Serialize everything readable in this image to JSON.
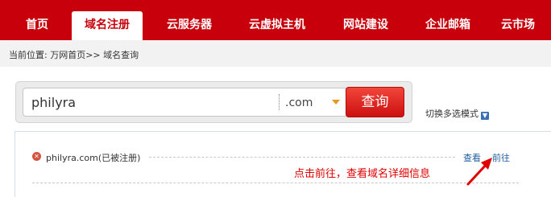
{
  "nav": {
    "tabs": [
      {
        "label": "首页",
        "active": false
      },
      {
        "label": "域名注册",
        "active": true
      },
      {
        "label": "云服务器",
        "active": false
      },
      {
        "label": "云虚拟主机",
        "active": false
      },
      {
        "label": "网站建设",
        "active": false
      },
      {
        "label": "企业邮箱",
        "active": false
      },
      {
        "label": "云市场",
        "active": false
      }
    ]
  },
  "breadcrumb": {
    "text": "当前位置: 万网首页>> 域名查询"
  },
  "search": {
    "value": "philyra",
    "tld": ".com",
    "button_label": "查询",
    "mode_toggle_label": "切换多选模式",
    "mode_icon": "chevron-down-icon"
  },
  "results": {
    "items": [
      {
        "domain": "philyra.com",
        "status": "(已被注册)",
        "status_icon": "close-circle-icon",
        "view_label": "查看",
        "go_label": "前往"
      }
    ],
    "annotation": "点击前往，查看域名详细信息"
  },
  "colors": {
    "brand_red": "#c8000b",
    "link_blue": "#1f5c9e",
    "annotation_red": "#e00000",
    "dropdown_arrow": "#e59a1c"
  }
}
